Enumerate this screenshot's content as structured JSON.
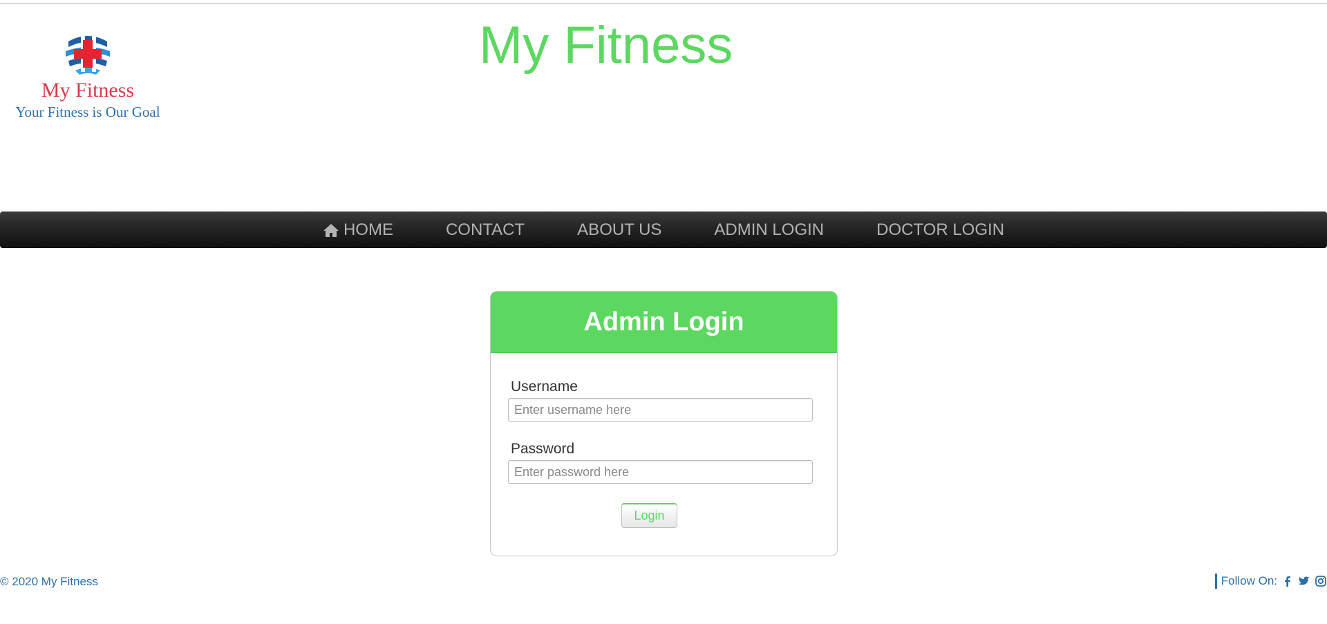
{
  "header": {
    "logo_name": "My Fitness",
    "logo_tagline": "Your Fitness is Our Goal",
    "site_title": "My Fitness"
  },
  "nav": {
    "items": [
      {
        "label": "HOME",
        "icon": "home-icon"
      },
      {
        "label": "CONTACT"
      },
      {
        "label": "ABOUT US"
      },
      {
        "label": "ADMIN LOGIN"
      },
      {
        "label": "DOCTOR LOGIN"
      }
    ]
  },
  "login": {
    "title": "Admin Login",
    "username_label": "Username",
    "username_placeholder": "Enter username here",
    "username_value": "",
    "password_label": "Password",
    "password_placeholder": "Enter password here",
    "password_value": "",
    "button_label": "Login"
  },
  "footer": {
    "copyright": "© 2020 My Fitness",
    "follow_label": "Follow On:",
    "social_icons": [
      "facebook-icon",
      "twitter-icon",
      "instagram-icon"
    ]
  },
  "colors": {
    "accent_green": "#5cd760",
    "logo_red": "#d93a4a",
    "link_blue": "#2b6ea6",
    "navbar_dark": "#1a1a1a"
  }
}
